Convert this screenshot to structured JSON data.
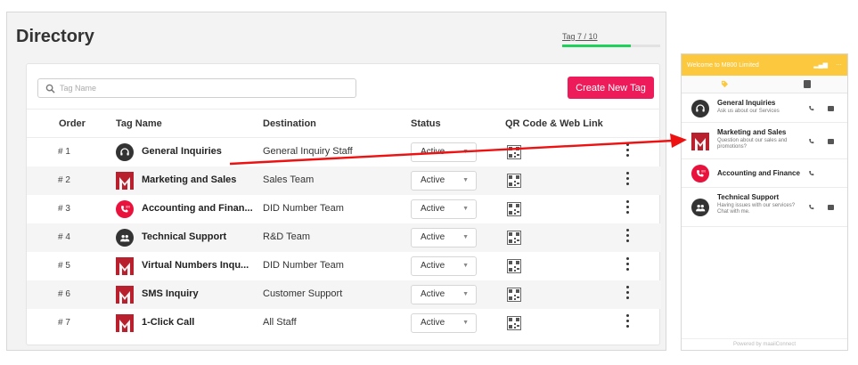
{
  "page": {
    "title": "Directory",
    "progress": {
      "text": "Tag 7 / 10",
      "current": 7,
      "total": 10
    }
  },
  "search": {
    "placeholder": "Tag Name"
  },
  "create_button": {
    "label": "Create New Tag"
  },
  "table": {
    "headers": [
      "Order",
      "Tag Name",
      "Destination",
      "Status",
      "QR Code & Web Link"
    ],
    "rows": [
      {
        "order": "# 1",
        "name": "General Inquiries",
        "destination": "General Inquiry Staff",
        "status": "Active",
        "icon": "headset-icon"
      },
      {
        "order": "# 2",
        "name": "Marketing and Sales",
        "destination": "Sales Team",
        "status": "Active",
        "icon": "m800-logo-icon"
      },
      {
        "order": "# 3",
        "name": "Accounting and Finan...",
        "destination": "DID Number Team",
        "status": "Active",
        "icon": "phone-800-icon"
      },
      {
        "order": "# 4",
        "name": "Technical Support",
        "destination": "R&D Team",
        "status": "Active",
        "icon": "group-icon"
      },
      {
        "order": "# 5",
        "name": "Virtual Numbers Inqu...",
        "destination": "DID Number Team",
        "status": "Active",
        "icon": "m800-logo-icon"
      },
      {
        "order": "# 6",
        "name": "SMS Inquiry",
        "destination": "Customer Support",
        "status": "Active",
        "icon": "m800-logo-icon"
      },
      {
        "order": "# 7",
        "name": "1-Click Call",
        "destination": "All Staff",
        "status": "Active",
        "icon": "m800-logo-icon"
      }
    ]
  },
  "widget": {
    "header": "Welcome to M800 Limited",
    "footer": "Powered by maaiiConnect",
    "items": [
      {
        "title": "General Inquiries",
        "subtitle": "Ask us about our Services",
        "icon": "headset-icon",
        "phone": true,
        "chat": true
      },
      {
        "title": "Marketing and Sales",
        "subtitle": "Question about our sales and promotions?",
        "icon": "m800-logo-icon",
        "phone": true,
        "chat": true
      },
      {
        "title": "Accounting and Finance",
        "subtitle": "",
        "icon": "phone-800-icon",
        "phone": true,
        "chat": false
      },
      {
        "title": "Technical Support",
        "subtitle": "Having issues with our services? Chat with me.",
        "icon": "group-icon",
        "phone": true,
        "chat": true
      }
    ]
  },
  "colors": {
    "accent": "#ee1b5a",
    "progress": "#1fd15a",
    "widget_header": "#fcc93e",
    "arrow": "#ee1111",
    "brand_red": "#b8202d"
  }
}
